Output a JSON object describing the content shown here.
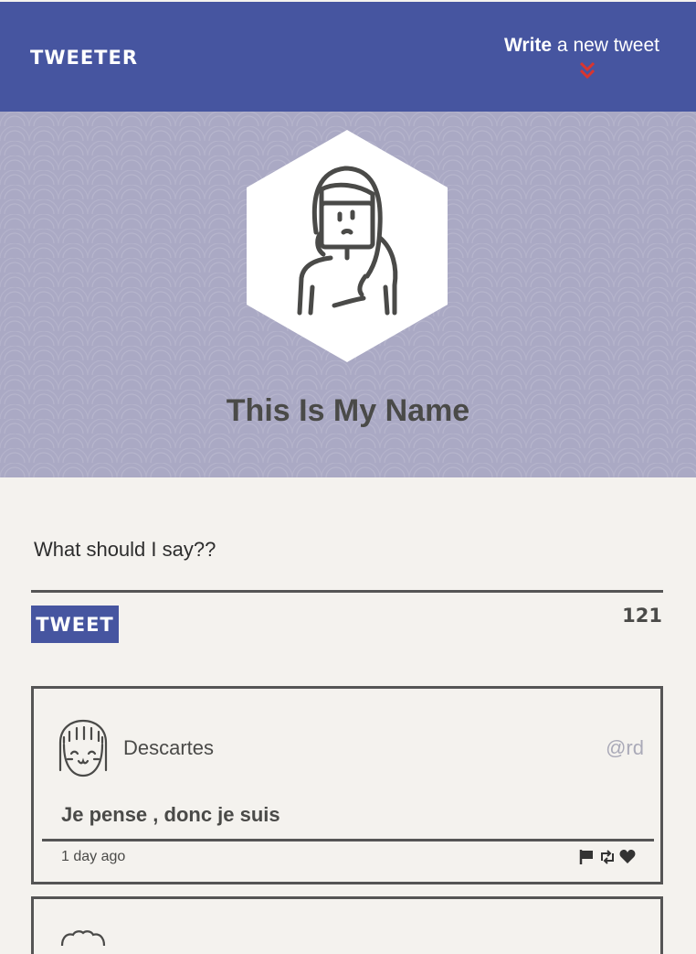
{
  "nav": {
    "brand": "TWEETER",
    "compose_bold": "Write",
    "compose_rest": " a new tweet"
  },
  "profile": {
    "name": "This Is My Name"
  },
  "composer": {
    "text": "What should I say??",
    "tweet_button": "TWEET",
    "char_count": "121"
  },
  "tweets": [
    {
      "name": "Descartes",
      "handle": "@rd",
      "body": "Je pense , donc je suis",
      "time": "1 day ago",
      "actions": [
        "flag-icon",
        "retweet-icon",
        "heart-icon"
      ]
    }
  ],
  "colors": {
    "brand_blue": "#4655a0",
    "hero_lavender": "#aaa9c4",
    "accent_red": "#d9352f",
    "background": "#f4f2ee"
  }
}
